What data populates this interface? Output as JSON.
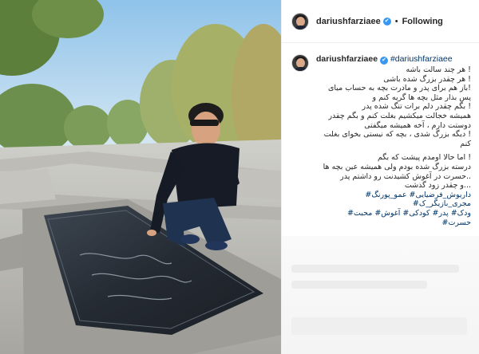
{
  "post": {
    "username": "dariushfarziaee",
    "verified_mark": "✔",
    "separator": "•",
    "follow_status": "Following"
  },
  "comment": {
    "username": "dariushfarziaee",
    "hashtag": "#dariushfarziaee",
    "caption_lines": [
      "! هر چند سالت باشه",
      "! هر چقدر بزرگ شده باشی",
      "!باز هم برای پدر و مادرت بچه به حساب میای",
      "پس بذار مثل بچه ها گریه کنم و",
      "! بگم چقدر دلم برات تنگ شده پدر",
      "همیشه خجالت میکشیم بغلت کنم و بگم چقدر",
      "دوستت دارم ، آخه همیشه میگفتی",
      "! دیگه بزرگ شدی ، بچه که نیستی بخوای بغلت کنم",
      "",
      "! اما حالا اومدم پیشت که بگم",
      "درسته بزرگ شده بودم ولی همیشه عین بچه ها",
      "..حسرت در آغوش کشیدنت رو داشتم پدر",
      "...و چقدر زود گذشت"
    ],
    "tags_line_1": "داریوش_فرضیایی# عمو_پورنگ# مجری_بازیگر_ک#",
    "tags_line_2": "ودک# پدر# کودکی# آغوش# محبت# حسرت#"
  },
  "icons": {
    "avatar": "profile-avatar",
    "verified": "verified-badge-icon"
  }
}
